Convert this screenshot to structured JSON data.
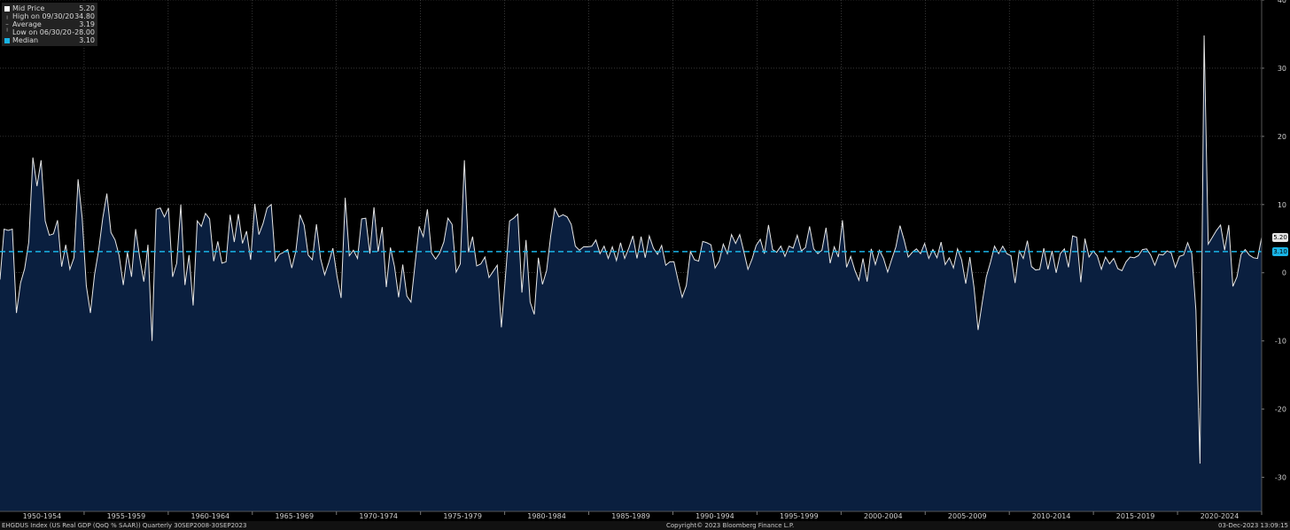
{
  "chart_data": {
    "type": "area",
    "series": [
      {
        "name": "Mid Price",
        "quarter_start": "1947Q2",
        "values": [
          -1.0,
          6.4,
          6.2,
          6.4,
          -5.9,
          -1.5,
          0.6,
          4.5,
          16.9,
          12.7,
          16.5,
          7.6,
          5.5,
          5.7,
          7.7,
          0.9,
          4.1,
          0.5,
          2.2,
          13.7,
          8.0,
          -1.9,
          -5.9,
          -0.3,
          3.3,
          8.0,
          11.6,
          5.9,
          4.8,
          2.5,
          -1.8,
          3.0,
          -0.6,
          6.4,
          2.2,
          -1.3,
          4.1,
          -10.0,
          9.3,
          9.5,
          8.2,
          9.5,
          -0.6,
          1.4,
          10.0,
          -1.8,
          2.6,
          -4.8,
          7.6,
          6.8,
          8.7,
          7.9,
          1.7,
          4.6,
          1.4,
          1.6,
          8.5,
          4.5,
          8.6,
          4.3,
          6.1,
          1.9,
          10.1,
          5.6,
          7.2,
          9.5,
          10.0,
          1.7,
          2.7,
          3.0,
          3.4,
          0.7,
          3.2,
          8.5,
          7.0,
          2.6,
          1.9,
          7.1,
          2.1,
          -0.3,
          1.5,
          3.6,
          -0.5,
          -3.7,
          11.0,
          2.5,
          3.3,
          2.1,
          7.9,
          8.0,
          2.8,
          9.6,
          3.1,
          6.7,
          -2.1,
          3.7,
          0.9,
          -3.6,
          1.2,
          -3.4,
          -4.3,
          1.3,
          6.8,
          5.3,
          9.3,
          2.9,
          2.0,
          2.9,
          4.5,
          8.0,
          7.1,
          0.1,
          1.3,
          16.5,
          3.0,
          5.3,
          1.0,
          1.3,
          2.3,
          -0.7,
          0.2,
          1.1,
          -8.0,
          -0.5,
          7.6,
          8.0,
          8.6,
          -2.9,
          4.8,
          -4.3,
          -6.1,
          2.2,
          -1.7,
          0.3,
          5.4,
          9.4,
          8.2,
          8.5,
          8.2,
          7.1,
          3.9,
          3.3,
          3.8,
          3.8,
          3.9,
          4.8,
          2.8,
          3.9,
          2.1,
          3.8,
          1.8,
          4.4,
          2.1,
          3.6,
          5.4,
          2.1,
          5.3,
          2.2,
          5.4,
          3.6,
          2.7,
          4.0,
          1.1,
          1.6,
          1.6,
          -1.1,
          -3.6,
          -1.9,
          3.1,
          1.9,
          1.7,
          4.6,
          4.4,
          4.1,
          0.7,
          1.7,
          4.2,
          2.8,
          5.6,
          4.3,
          5.6,
          3.1,
          0.5,
          2.0,
          4.0,
          4.9,
          2.8,
          7.0,
          3.4,
          3.0,
          3.9,
          2.4,
          3.9,
          3.6,
          5.5,
          3.2,
          3.7,
          6.8,
          3.5,
          2.8,
          3.3,
          6.6,
          1.4,
          3.8,
          2.3,
          7.7,
          0.8,
          2.4,
          0.4,
          -1.1,
          2.1,
          -1.3,
          3.5,
          1.2,
          3.3,
          2.1,
          0.1,
          2.0,
          3.8,
          6.9,
          4.8,
          2.3,
          3.0,
          3.5,
          2.8,
          4.3,
          2.1,
          3.4,
          2.2,
          4.5,
          1.2,
          2.2,
          0.7,
          3.5,
          1.9,
          -1.6,
          2.3,
          -2.1,
          -8.4,
          -4.4,
          -0.6,
          1.5,
          3.9,
          2.8,
          3.9,
          2.8,
          2.5,
          -1.5,
          3.2,
          2.1,
          4.7,
          0.9,
          0.4,
          0.5,
          3.6,
          0.5,
          3.2,
          0.0,
          2.8,
          3.5,
          0.8,
          5.4,
          5.2,
          -1.4,
          5.0,
          2.3,
          3.2,
          2.5,
          0.5,
          2.3,
          1.3,
          2.1,
          0.6,
          0.3,
          1.6,
          2.3,
          2.2,
          2.5,
          3.4,
          3.5,
          2.6,
          1.1,
          2.7,
          2.6,
          3.2,
          2.9,
          0.8,
          2.4,
          2.6,
          4.4,
          2.8,
          -5.5,
          -28.0,
          34.8,
          4.2,
          5.2,
          6.2,
          7.0,
          3.3,
          7.0,
          -2.0,
          -0.6,
          2.7,
          3.4,
          2.6,
          2.2,
          2.1,
          5.2
        ]
      }
    ],
    "median": 3.1,
    "last_value": 5.2,
    "ylim": [
      -35,
      40
    ],
    "yticks": [
      40,
      30,
      20,
      10,
      0,
      -10,
      -20,
      -30
    ],
    "ytick_labels": [
      "40",
      "30",
      "20",
      "10",
      "0",
      "-10",
      "-20",
      "-30"
    ],
    "xlabels": [
      "1950-1954",
      "1955-1959",
      "1960-1964",
      "1965-1969",
      "1970-1974",
      "1975-1979",
      "1980-1984",
      "1985-1989",
      "1990-1994",
      "1995-1999",
      "2000-2004",
      "2005-2009",
      "2010-2014",
      "2015-2019",
      "2020-2024"
    ],
    "grid": true,
    "legend_position": "top-left",
    "line_color": "#e6e6e6",
    "fill_color": "#0a1f3f",
    "median_color": "#19b4e6",
    "background": "#000000"
  },
  "legend": {
    "rows": [
      {
        "label": "Mid Price",
        "value": "5.20",
        "marker": "white-square"
      },
      {
        "label": "High on 09/30/20",
        "value": "34.80",
        "marker": "high-tick"
      },
      {
        "label": "Average",
        "value": "3.19",
        "marker": "average-tick"
      },
      {
        "label": "Low on 06/30/20",
        "value": "-28.00",
        "marker": "low-tick"
      },
      {
        "label": "Median",
        "value": "3.10",
        "marker": "cyan-square"
      }
    ]
  },
  "tags": {
    "last": "5.20",
    "median": "3.10"
  },
  "footer": {
    "left": "EHGDUS Index  (US Real GDP (QoQ % SAAR))  Quarterly 30SEP2008-30SEP2023",
    "center": "Copyright© 2023 Bloomberg Finance L.P.",
    "right": "03-Dec-2023 13:09:15"
  }
}
